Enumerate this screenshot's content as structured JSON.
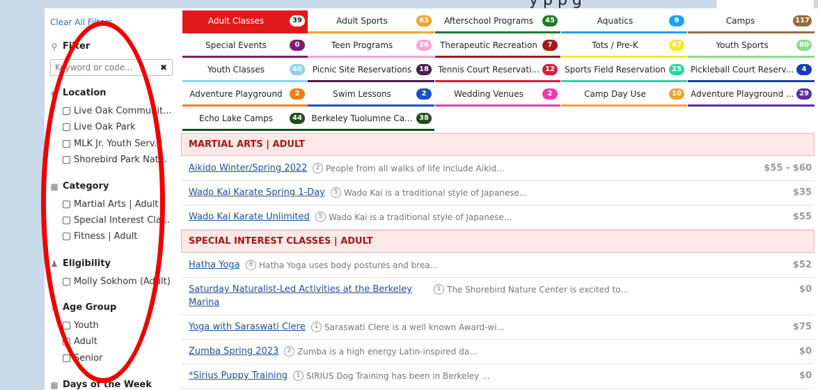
{
  "page": {
    "title_fragment": "y       p     p g"
  },
  "sidebar": {
    "clear_all": "Clear All Filters",
    "filter": {
      "title": "Filter",
      "placeholder": "Keyword or code..."
    },
    "location": {
      "title": "Location",
      "options": [
        "Live Oak Communit...",
        "Live Oak Park",
        "MLK Jr. Youth Serv...",
        "Shorebird Park Nat..."
      ]
    },
    "category": {
      "title": "Category",
      "options": [
        "Martial Arts | Adult",
        "Special Interest Cla...",
        "Fitness | Adult"
      ]
    },
    "eligibility": {
      "title": "Eligibility",
      "options": [
        "Molly Sokhom (Adult)"
      ]
    },
    "age_group": {
      "title": "Age Group",
      "options": [
        "Youth",
        "Adult",
        "Senior"
      ]
    },
    "days": {
      "title": "Days of the Week"
    }
  },
  "tabs": [
    {
      "label": "Adult Classes",
      "count": "39",
      "color": "#e2191b"
    },
    {
      "label": "Adult Sports",
      "count": "63",
      "color": "#f2a52b"
    },
    {
      "label": "Afterschool Programs",
      "count": "45",
      "color": "#1e7b2a"
    },
    {
      "label": "Aquatics",
      "count": "9",
      "color": "#1aa6e8"
    },
    {
      "label": "Camps",
      "count": "117",
      "color": "#9a6a3d"
    },
    {
      "label": "Special Events",
      "count": "0",
      "color": "#7d1d6e"
    },
    {
      "label": "Teen Programs",
      "count": "26",
      "color": "#f4a6d7"
    },
    {
      "label": "Therapeutic Recreation",
      "count": "7",
      "color": "#a31919"
    },
    {
      "label": "Tots / Pre-K",
      "count": "47",
      "color": "#f1ea31"
    },
    {
      "label": "Youth Sports",
      "count": "80",
      "color": "#8edb8e"
    },
    {
      "label": "Youth Classes",
      "count": "40",
      "color": "#8ad2f0"
    },
    {
      "label": "Picnic Site Reservations",
      "count": "18",
      "color": "#4a1b4b"
    },
    {
      "label": "Tennis Court Reservati...",
      "count": "12",
      "color": "#e21c3a"
    },
    {
      "label": "Sports Field Reservation",
      "count": "25",
      "color": "#2dd4a4"
    },
    {
      "label": "Pickleball Court Reserv...",
      "count": "4",
      "color": "#1a3fb5"
    },
    {
      "label": "Adventure Playground",
      "count": "2",
      "color": "#f07e14"
    },
    {
      "label": "Swim Lessons",
      "count": "2",
      "color": "#1b4fcc"
    },
    {
      "label": "Wedding Venues",
      "count": "2",
      "color": "#e63dad"
    },
    {
      "label": "Camp Day Use",
      "count": "10",
      "color": "#f0a330"
    },
    {
      "label": "Adventure Playground ...",
      "count": "29",
      "color": "#5a2ea8"
    },
    {
      "label": "Echo Lake Camps",
      "count": "44",
      "color": "#1f4d1f"
    },
    {
      "label": "Berkeley Tuolumne Ca...",
      "count": "38",
      "color": "#1f4d1f"
    }
  ],
  "sections": [
    {
      "header": "MARTIAL ARTS | ADULT",
      "items": [
        {
          "title": "Aikido Winter/Spring 2022",
          "count": "2",
          "desc": "People from all walks of life include Aikid...",
          "price": "$55 - $60"
        },
        {
          "title": "Wado Kai Karate Spring 1-Day",
          "count": "5",
          "desc": "Wado Kai is a traditional style of Japanese...",
          "price": "$35"
        },
        {
          "title": "Wado Kai Karate Unlimited",
          "count": "5",
          "desc": "Wado Kai is a traditional style of Japanese...",
          "price": "$55"
        }
      ]
    },
    {
      "header": "SPECIAL INTEREST CLASSES | ADULT",
      "items": [
        {
          "title": "Hatha Yoga",
          "count": "8",
          "desc": "Hatha Yoga uses body postures and brea...",
          "price": "$52"
        },
        {
          "title": "Saturday Naturalist-Led Activities at the Berkeley",
          "title2": "Marina",
          "count": "1",
          "desc": "The Shorebird Nature Center is excited to...",
          "price": "$0"
        },
        {
          "title": "Yoga with Saraswati Clere",
          "count": "1",
          "desc": "Saraswati Clere is a well known Award-wi...",
          "price": "$75"
        },
        {
          "title": "Zumba Spring 2023",
          "count": "2",
          "desc": "Zumba is a high energy Latin-inspired da...",
          "price": "$0"
        },
        {
          "title": "*Sirius Puppy Training",
          "count": "1",
          "desc": "SIRIUS Dog Training has been in Berkeley ...",
          "price": "$0"
        }
      ]
    }
  ]
}
